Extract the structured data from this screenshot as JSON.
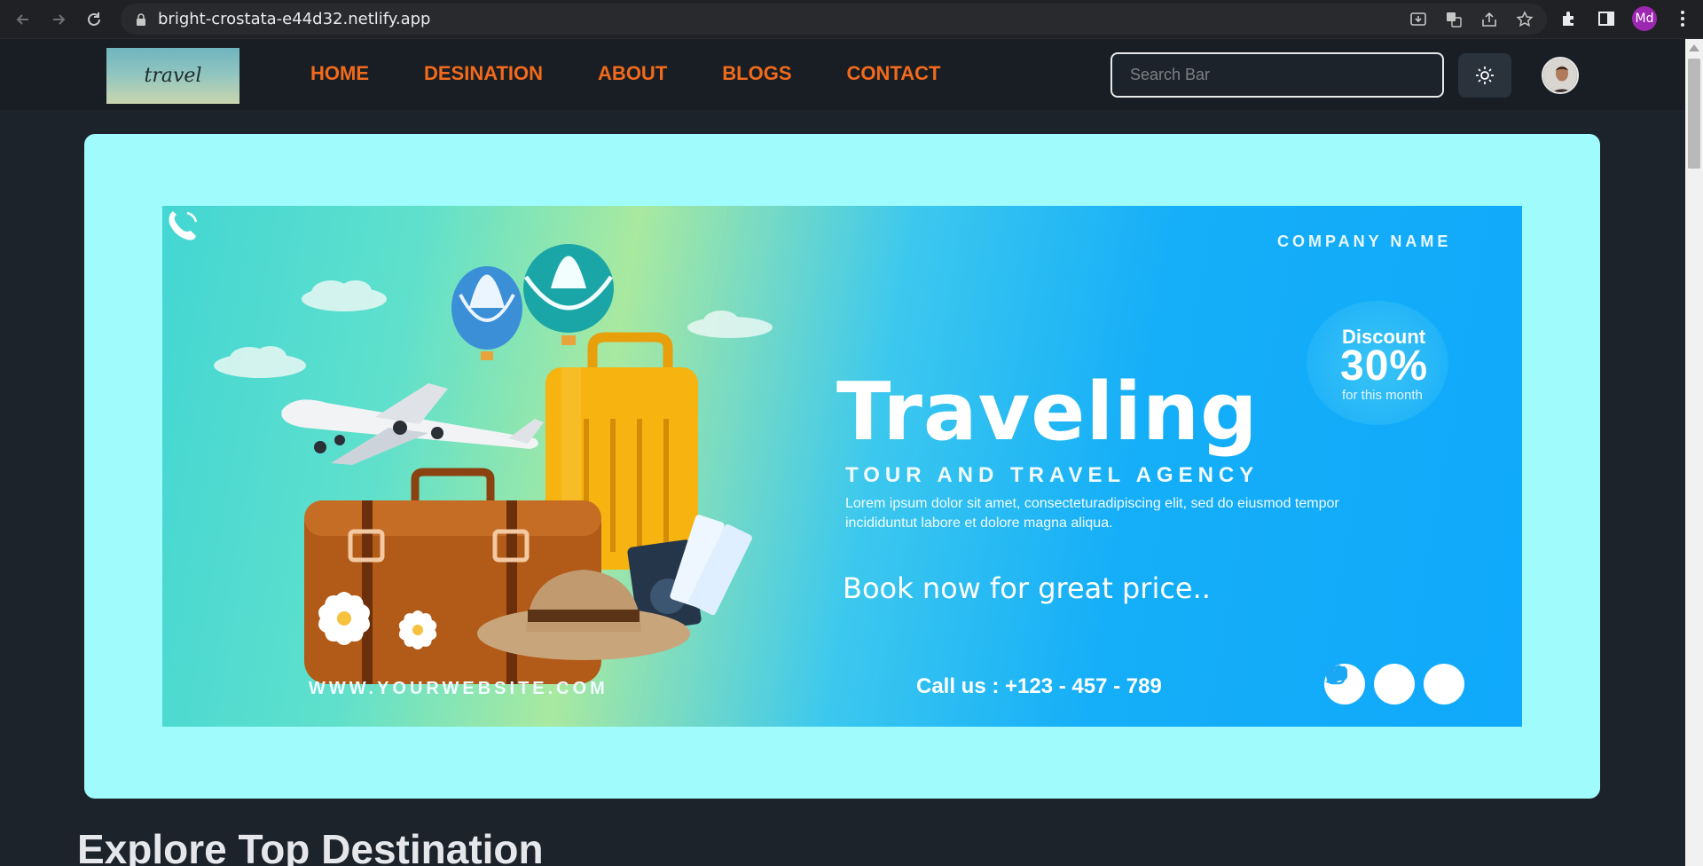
{
  "browser": {
    "url": "bright-crostata-e44d32.netlify.app",
    "profile_initials": "Md"
  },
  "header": {
    "logo_text": "travel",
    "nav": [
      "HOME",
      "DESINATION",
      "ABOUT",
      "BLOGS",
      "CONTACT"
    ],
    "search_placeholder": "Search Bar",
    "accent": "#f26a1b"
  },
  "hero": {
    "company": "COMPANY NAME",
    "discount_label": "Discount",
    "discount_value": "30%",
    "discount_sub": "for this month",
    "headline": "Traveling",
    "tagline": "TOUR AND TRAVEL AGENCY",
    "lorem": "Lorem ipsum dolor sit amet, consecteturadipiscing elit, sed do eiusmod tempor incididuntut labore et dolore magna aliqua.",
    "cta": "Book now for great price..",
    "website": "WWW.YOURWEBSITE.COM",
    "call": "Call us : +123 - 457 - 789",
    "background": "#a0fcfc"
  },
  "section": {
    "title": "Explore Top Destination"
  }
}
